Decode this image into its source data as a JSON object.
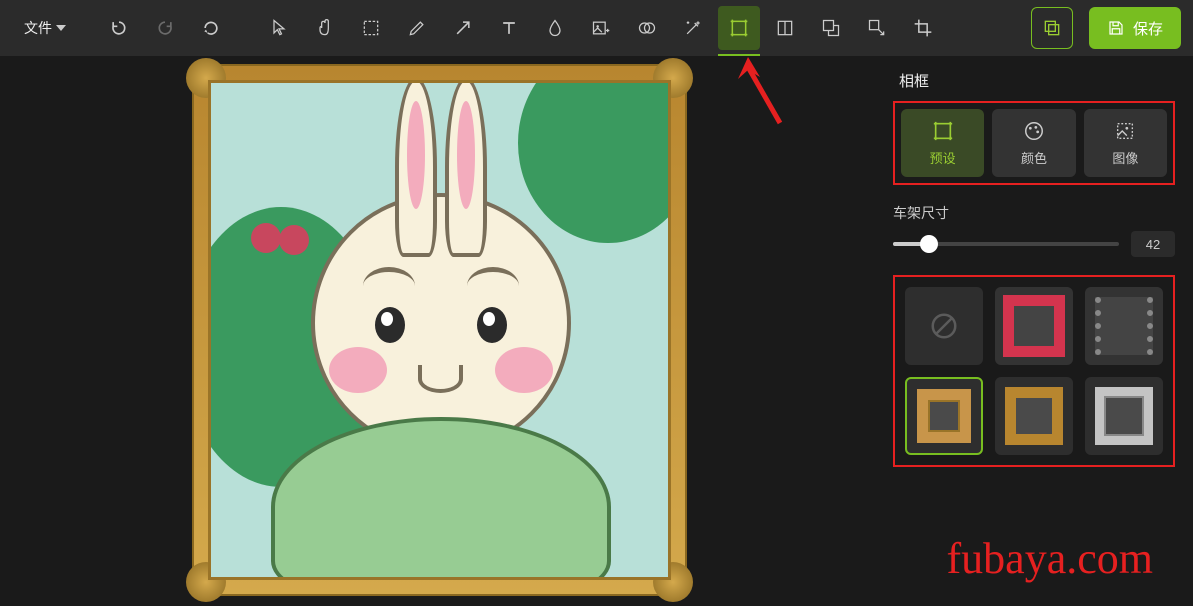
{
  "toolbar": {
    "file_label": "文件",
    "save_label": "保存"
  },
  "panel": {
    "title": "相框",
    "modes": {
      "preset": "预设",
      "color": "颜色",
      "image": "图像"
    },
    "slider_label": "车架尺寸",
    "slider_value": "42"
  },
  "watermark": "fubaya.com"
}
